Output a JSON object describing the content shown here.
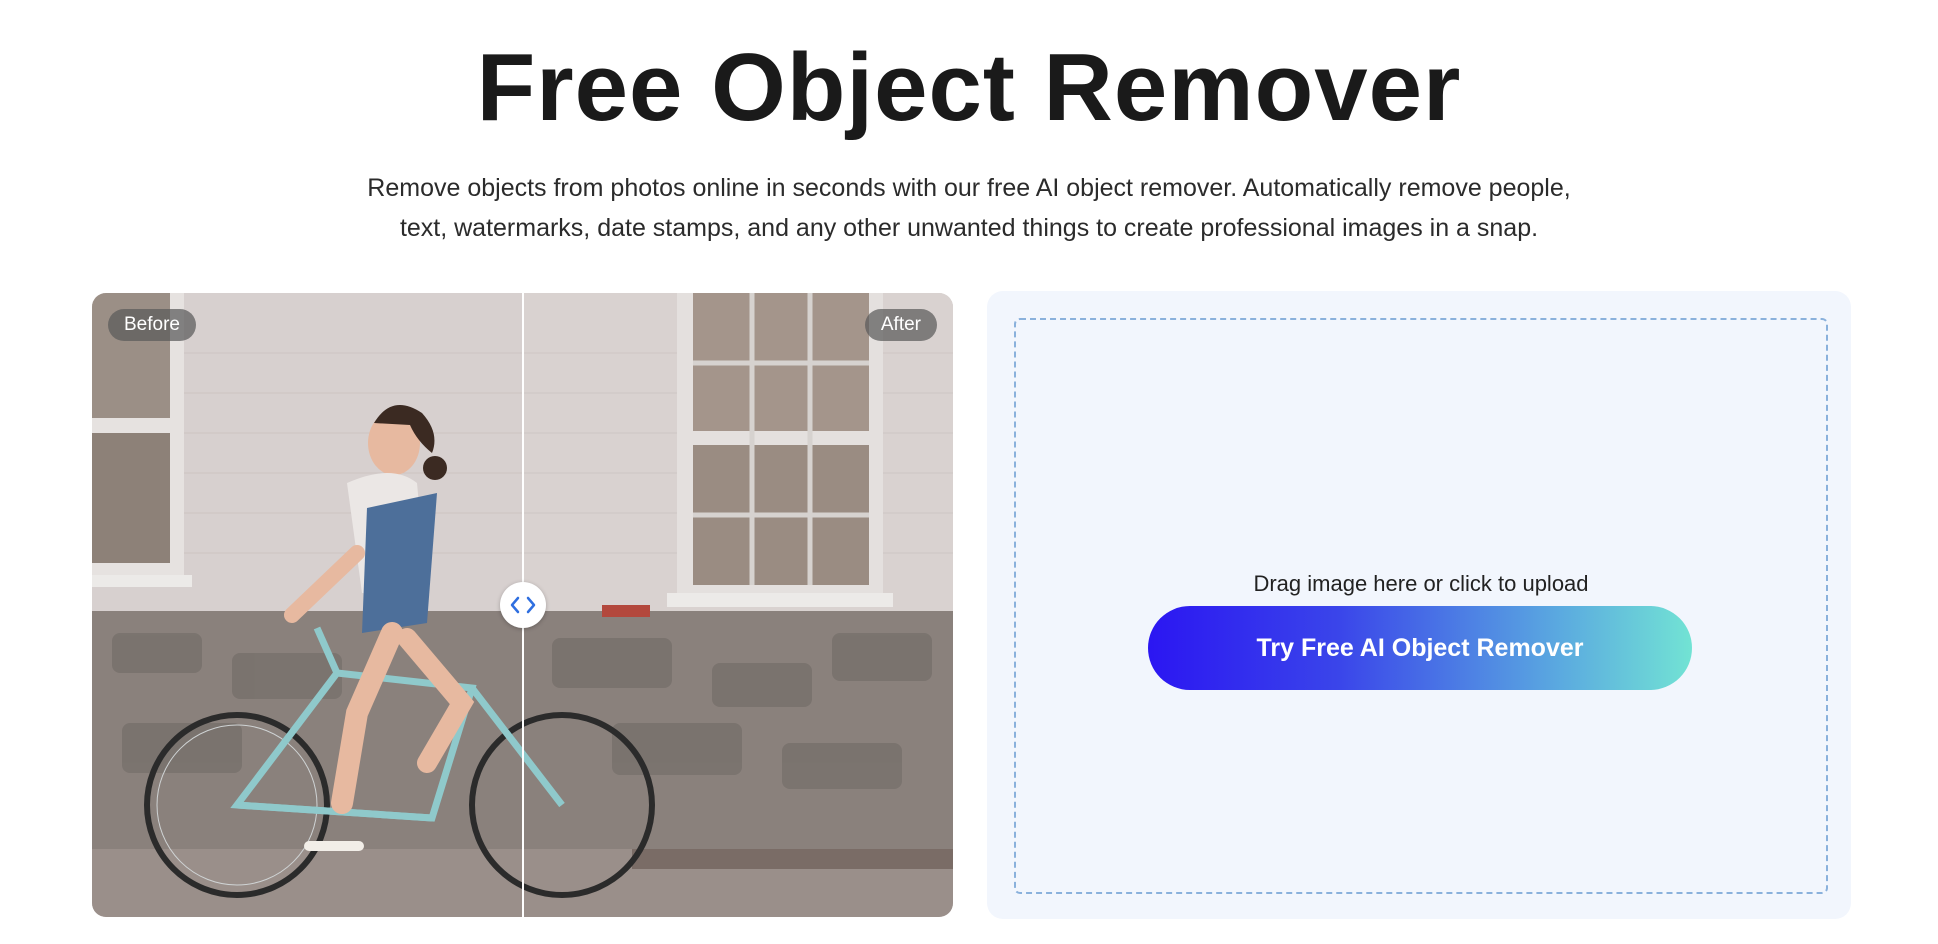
{
  "hero": {
    "title": "Free Object Remover",
    "subtitle_line1": "Remove objects from photos online in seconds with our free AI object remover. Automatically remove people,",
    "subtitle_line2": "text, watermarks, date stamps, and any other unwanted things to create professional images in a snap."
  },
  "comparison": {
    "before_label": "Before",
    "after_label": "After",
    "handle_icon": "left-right-chevrons-icon"
  },
  "upload": {
    "hint": "Drag image here or click to upload",
    "button_label": "Try Free AI Object Remover"
  },
  "colors": {
    "button_gradient_start": "#2b16f2",
    "button_gradient_end": "#72e3d4",
    "panel_background": "#f2f6fd",
    "dropzone_border": "#8ab1dc",
    "handle_chevrons": "#2f6fe0"
  }
}
